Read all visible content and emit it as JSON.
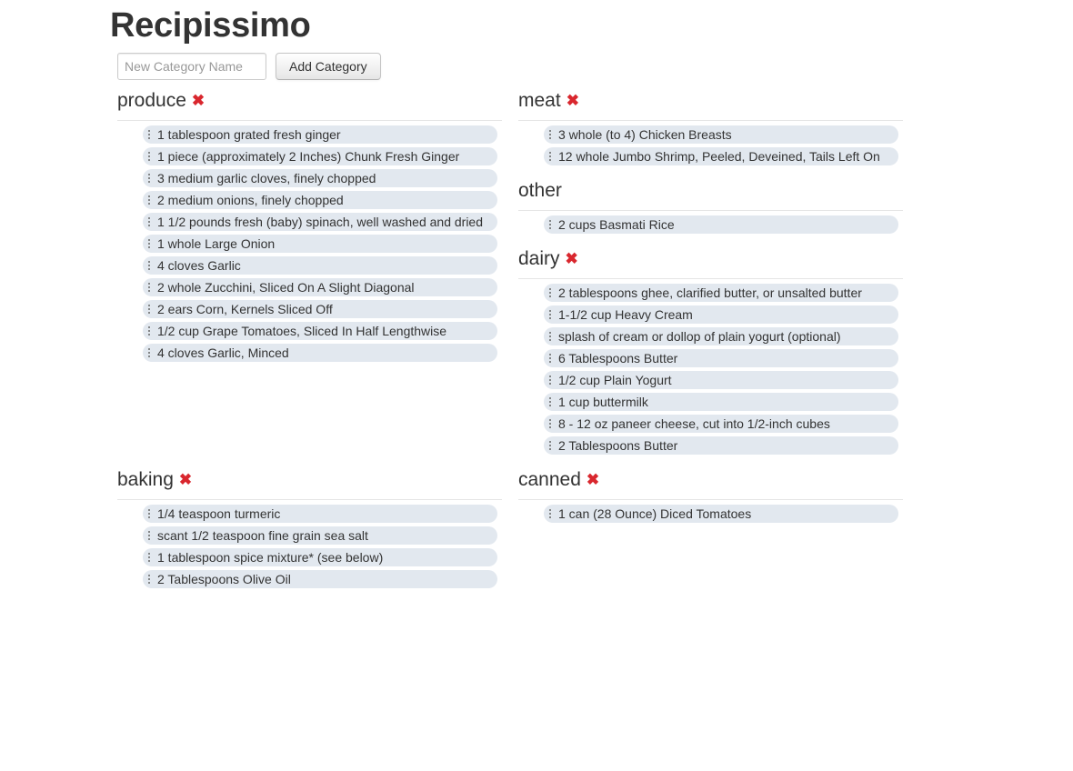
{
  "app": {
    "title": "Recipissimo"
  },
  "add_form": {
    "input_placeholder": "New Category Name",
    "input_value": "",
    "button_label": "Add Category"
  },
  "colors": {
    "delete_icon": "#d9272e",
    "item_background": "#e2e8ef"
  },
  "categories": [
    {
      "name": "produce",
      "deletable": true,
      "delete_icon": "close-icon",
      "items": [
        "1 tablespoon grated fresh ginger",
        "1 piece (approximately 2 Inches) Chunk Fresh Ginger",
        "3 medium garlic cloves, finely chopped",
        "2 medium onions, finely chopped",
        "1 1/2 pounds fresh (baby) spinach, well washed and dried",
        "1 whole Large Onion",
        "4 cloves Garlic",
        "2 whole Zucchini, Sliced On A Slight Diagonal",
        "2 ears Corn, Kernels Sliced Off",
        "1/2 cup Grape Tomatoes, Sliced In Half Lengthwise",
        "4 cloves Garlic, Minced"
      ]
    },
    {
      "name": "meat",
      "deletable": true,
      "delete_icon": "close-icon",
      "items": [
        "3 whole (to 4) Chicken Breasts",
        "12 whole Jumbo Shrimp, Peeled, Deveined, Tails Left On"
      ]
    },
    {
      "name": "other",
      "deletable": false,
      "items": [
        "2 cups Basmati Rice"
      ]
    },
    {
      "name": "dairy",
      "deletable": true,
      "delete_icon": "close-icon",
      "items": [
        "2 tablespoons ghee, clarified butter, or unsalted butter",
        "1-1/2 cup Heavy Cream",
        "splash of cream or dollop of plain yogurt (optional)",
        "6 Tablespoons Butter",
        "1/2 cup Plain Yogurt",
        "1 cup buttermilk",
        "8 - 12 oz paneer cheese, cut into 1/2-inch cubes",
        "2 Tablespoons Butter"
      ]
    },
    {
      "name": "baking",
      "deletable": true,
      "delete_icon": "close-icon",
      "items": [
        "1/4 teaspoon turmeric",
        "scant 1/2 teaspoon fine grain sea salt",
        "1 tablespoon spice mixture* (see below)",
        "2 Tablespoons Olive Oil"
      ]
    },
    {
      "name": "canned",
      "deletable": true,
      "delete_icon": "close-icon",
      "items": [
        "1 can (28 Ounce) Diced Tomatoes"
      ]
    }
  ]
}
